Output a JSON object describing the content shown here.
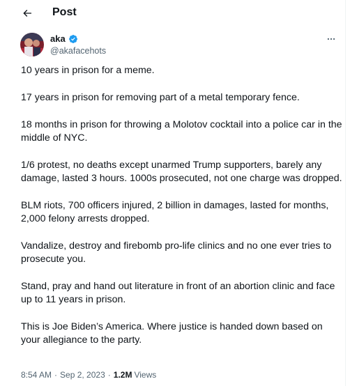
{
  "header": {
    "title": "Post"
  },
  "author": {
    "name": "aka",
    "handle": "@akafacehots",
    "verified": true
  },
  "post": {
    "paragraphs": [
      "10 years in prison for a meme.",
      "17 years in prison for removing part of a metal temporary fence.",
      "18 months in prison for throwing a Molotov cocktail into a police car in the middle of NYC.",
      "1/6 protest, no deaths except unarmed Trump supporters, barely any damage, lasted 3 hours. 1000s prosecuted, not one charge was dropped.",
      "BLM riots, 700 officers injured, 2 billion in damages, lasted for months, 2,000 felony arrests dropped.",
      "Vandalize, destroy and firebomb pro-life clinics and no one ever tries to prosecute you.",
      "Stand, pray and hand out literature in front of an abortion clinic and face up to 11 years in prison.",
      "This is Joe Biden’s America. Where justice is handed down based on your allegiance to the party."
    ],
    "time": "8:54 AM",
    "separator": "·",
    "date": "Sep 2, 2023",
    "views_count": "1.2M",
    "views_label": "Views"
  },
  "colors": {
    "text": "#0f1419",
    "secondary": "#536471",
    "verified_blue": "#1d9bf0"
  },
  "icons": {
    "back": "arrow-left-icon",
    "verified": "verified-badge-icon",
    "more": "more-horizontal-icon"
  }
}
